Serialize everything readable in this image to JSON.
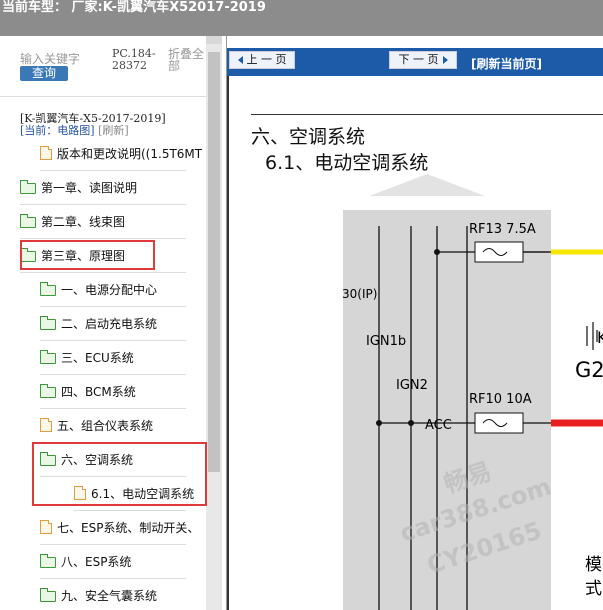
{
  "topbar": {
    "title": "当前车型：  厂家:K-凯翼汽车X52017-2019"
  },
  "sidebar": {
    "search_placeholder": "输入关键字",
    "search_button": "查询",
    "pc_code": "PC.184-28372",
    "collapse_all": "折叠全部",
    "car_title": "[K-凯翼汽车-X5-2017-2019]",
    "current_prefix": "[当前：电路图]",
    "refresh_link": "[刷新]",
    "items": [
      {
        "label": "版本和更改说明((1.5T6MT",
        "type": "doc"
      },
      {
        "label": "第一章、读图说明",
        "type": "folder"
      },
      {
        "label": "第二章、线束图",
        "type": "folder"
      },
      {
        "label": "第三章、原理图",
        "type": "folder"
      },
      {
        "label": "一、电源分配中心",
        "type": "folder"
      },
      {
        "label": "二、启动充电系统",
        "type": "folder"
      },
      {
        "label": "三、ECU系统",
        "type": "folder"
      },
      {
        "label": "四、BCM系统",
        "type": "folder"
      },
      {
        "label": "五、组合仪表系统",
        "type": "doc"
      },
      {
        "label": "六、空调系统",
        "type": "folder"
      },
      {
        "label": "6.1、电动空调系统",
        "type": "doc"
      },
      {
        "label": "七、ESP系统、制动开关、",
        "type": "doc"
      },
      {
        "label": "八、ESP系统",
        "type": "folder"
      },
      {
        "label": "九、安全气囊系统",
        "type": "folder"
      }
    ]
  },
  "content": {
    "prev_page": "上 一 页",
    "next_page": "下 一 页",
    "refresh_page": "[刷新当前页]",
    "heading_1": "六、空调系统",
    "heading_2": "6.1、电动空调系统",
    "wires": [
      "30(IP)",
      "IGN1b",
      "IGN2",
      "ACC"
    ],
    "fuse_1": "RF13 7.5A",
    "fuse_2": "RF10 10A",
    "right_fragment_1": "K",
    "right_fragment_2": "G2",
    "right_fragment_3": "模",
    "right_fragment_4": "式",
    "watermark_1": "畅易",
    "watermark_2": "car388.com",
    "watermark_3": "CY20165",
    "colors": {
      "accent": "#1d5aa8",
      "highlight_box": "#e03a3a",
      "wire_red": "#e82020",
      "wire_yellow": "#f5e600"
    }
  }
}
